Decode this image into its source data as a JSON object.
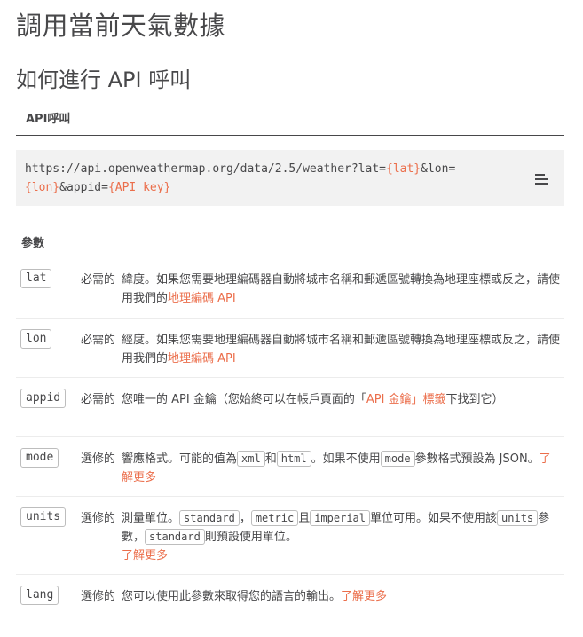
{
  "page": {
    "title": "調用當前天氣數據"
  },
  "section": {
    "title": "如何進行 API 呼叫"
  },
  "tab": {
    "label": "API呼叫"
  },
  "code": {
    "prefix": "https://api.openweathermap.org/data/2.5/weather?lat=",
    "lat": "{lat}",
    "mid1": "&lon=",
    "lon": "{lon}",
    "mid2": "&appid=",
    "key": "{API key}"
  },
  "params": {
    "heading": "參數",
    "rows": [
      {
        "name": "lat",
        "req": "必需的",
        "d1": "緯度。如果您需要地理編碼器自動將城市名稱和郵遞區號轉換為地理座標或反之，請使用我們的",
        "link": "地理編碼 API"
      },
      {
        "name": "lon",
        "req": "必需的",
        "d1": "經度。如果您需要地理編碼器自動將城市名稱和郵遞區號轉換為地理座標或反之，請使用我們的",
        "link": "地理編碼 API"
      },
      {
        "name": "appid",
        "req": "必需的",
        "d1": "您唯一的 API 金鑰（您始終可以在帳戶頁面的「",
        "link": "API 金鑰」標籤",
        "d2": "下找到它）"
      },
      {
        "name": "mode",
        "req": "選修的",
        "d1": "響應格式。可能的值為",
        "c1": "xml",
        "d2": "和",
        "c2": "html",
        "d3": "。如果不使用",
        "c3": "mode",
        "d4": "參數格式預設為 JSON。",
        "link": "了解更多"
      },
      {
        "name": "units",
        "req": "選修的",
        "d1": "測量單位。",
        "c1": "standard",
        "d2": "，",
        "c2": "metric",
        "d3": "且",
        "c3": "imperial",
        "d4": "單位可用。如果不使用該",
        "c4": "units",
        "d5": "參數，",
        "c5": "standard",
        "d6": "則預設使用單位。",
        "link": "了解更多"
      },
      {
        "name": "lang",
        "req": "選修的",
        "d1": "您可以使用此參數來取得您的語言的輸出。",
        "link": "了解更多"
      }
    ]
  }
}
